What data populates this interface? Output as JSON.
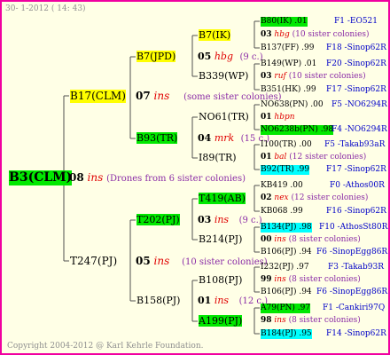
{
  "header": {
    "date": "30- 1-2012 ( 14: 43)"
  },
  "footer": {
    "copyright": "Copyright 2004-2012 @ Karl Kehrle Foundation."
  },
  "root": {
    "name": "B3(CLM)",
    "gen": "08",
    "mark": "ins",
    "note": "(Drones from 6 sister colonies)"
  },
  "gen1": [
    {
      "name": "B17(CLM)",
      "gen": "07",
      "mark": "ins",
      "note": "(some sister colonies)"
    },
    {
      "name": "T247(PJ)",
      "gen": "05",
      "mark": "ins",
      "note": "(10 sister colonies)"
    }
  ],
  "gen2": [
    {
      "name": "B7(JPD)",
      "gen": "05",
      "mark": "hbg",
      "note": "(9 c.)"
    },
    {
      "name": "B93(TR)",
      "gen": "04",
      "mark": "mrk",
      "note": "(15 c.)"
    },
    {
      "name": "T202(PJ)",
      "gen": "03",
      "mark": "ins",
      "note": "(9 c.)"
    },
    {
      "name": "B158(PJ)",
      "gen": "01",
      "mark": "ins",
      "note": "(12 c.)"
    }
  ],
  "gen3": [
    {
      "name": "B7(IK)"
    },
    {
      "name": "B339(WP)"
    },
    {
      "name": "NO61(TR)"
    },
    {
      "name": "I89(TR)"
    },
    {
      "name": "T419(AB)"
    },
    {
      "name": "B214(PJ)"
    },
    {
      "name": "B108(PJ)"
    },
    {
      "name": "A199(PJ)"
    }
  ],
  "gen4": [
    {
      "top": "B80(IK) .01",
      "top_id": "F1 -EO521",
      "mid_gen": "03",
      "mid_mark": "hbg",
      "mid_note": "(10 sister colonies)",
      "bot": "B137(FF) .99",
      "bot_id": "F18 -Sinop62R"
    },
    {
      "top": "B149(WP) .01",
      "top_id": "F20 -Sinop62R",
      "mid_gen": "03",
      "mid_mark": "ruf",
      "mid_note": "(10 sister colonies)",
      "bot": "B351(HK) .99",
      "bot_id": "F17 -Sinop62R"
    },
    {
      "top": "NO638(PN) .00",
      "top_id": "F5 -NO6294R",
      "mid_gen": "01",
      "mid_mark": "hbpn",
      "mid_note": "",
      "bot": "NO6238b(PN) .98",
      "bot_id": "F4 -NO6294R"
    },
    {
      "top": "I100(TR) .00",
      "top_id": "F5 -Takab93aR",
      "mid_gen": "01",
      "mid_mark": "bal",
      "mid_note": "(12 sister colonies)",
      "bot": "B92(TR) .99",
      "bot_id": "F17 -Sinop62R"
    },
    {
      "top": "KB419 .00",
      "top_id": "F0 -Athos00R",
      "mid_gen": "02",
      "mid_mark": "nex",
      "mid_note": "(12 sister colonies)",
      "bot": "KB068 .99",
      "bot_id": "F16 -Sinop62R"
    },
    {
      "top": "B134(PJ) .98",
      "top_id": "F10 -AthosSt80R",
      "mid_gen": "00",
      "mid_mark": "ins",
      "mid_note": "(8 sister colonies)",
      "bot": "B106(PJ) .94",
      "bot_id": "F6 -SinopEgg86R"
    },
    {
      "top": "I232(PJ) .97",
      "top_id": "F3 -Takab93R",
      "mid_gen": "99",
      "mid_mark": "ins",
      "mid_note": "(8 sister colonies)",
      "bot": "B106(PJ) .94",
      "bot_id": "F6 -SinopEgg86R"
    },
    {
      "top": "A79(PN) .97",
      "top_id": "F1 -Cankiri97Q",
      "mid_gen": "98",
      "mid_mark": "ins",
      "mid_note": "(8 sister colonies)",
      "bot": "B184(PJ) .95",
      "bot_id": "F14 -Sinop62R"
    }
  ],
  "colors": {
    "border": "#f000a0",
    "green": "#00e800",
    "yellow": "#ffff00",
    "cyan": "#00ffff",
    "mark_red": "#e00000",
    "note_purple": "#8a2ba6",
    "id_blue": "#0000c8"
  }
}
